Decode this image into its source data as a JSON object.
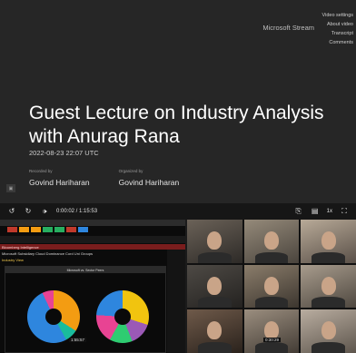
{
  "top_menu": {
    "video_settings": "Video settings",
    "about": "About video",
    "transcript": "Transcript",
    "comments": "Comments",
    "brand": "Microsoft Stream"
  },
  "lecture": {
    "title": "Guest Lecture on Industry Analysis with Anurag Rana",
    "datetime": "2022-08-23 22:07 UTC",
    "recorded_by_label": "Recorded by",
    "recorded_by": "Govind Hariharan",
    "organized_by_label": "Organized by",
    "organized_by": "Govind Hariharan"
  },
  "player": {
    "time": "0:00:02 / 1:15:53",
    "speed": "1x"
  },
  "share": {
    "line1": "Microsoft Subsidiary Cloud Dominance Cord Uni Groups",
    "line2": "Industry View",
    "section": "Bloomberg Intelligence",
    "panel_title": "Microsoft vs. Sector Peers",
    "time_badge": "1:55:57"
  },
  "participants": {
    "time_badge": "0:30:29"
  },
  "icons": {
    "rewind": "rewind-icon",
    "forward": "forward-icon",
    "volume": "volume-icon",
    "captions": "captions-icon",
    "settings": "settings-icon",
    "fullscreen": "fullscreen-icon"
  }
}
